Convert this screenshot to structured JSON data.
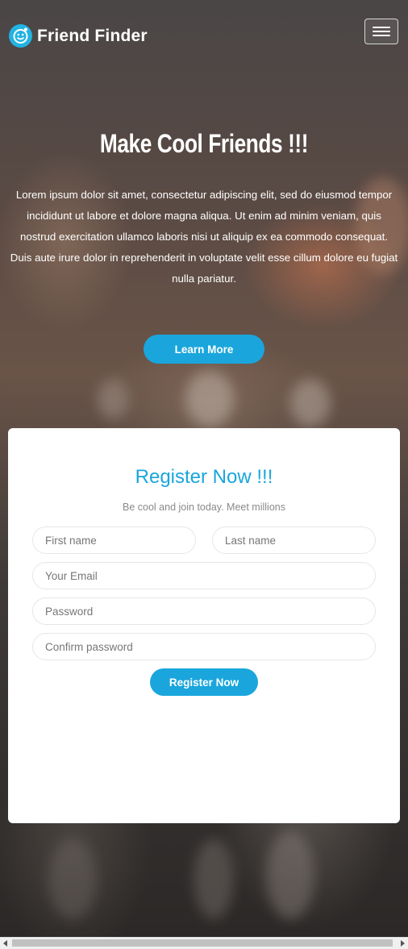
{
  "brand": {
    "name": "Friend Finder",
    "logo_icon": "smiley-face-icon",
    "accent_color": "#1aa6dc"
  },
  "navbar": {
    "menu_icon": "hamburger-menu-icon"
  },
  "hero": {
    "title": "Make Cool Friends !!!",
    "text": "Lorem ipsum dolor sit amet, consectetur adipiscing elit, sed do eiusmod tempor incididunt ut labore et dolore magna aliqua. Ut enim ad minim veniam, quis nostrud exercitation ullamco laboris nisi ut aliquip ex ea commodo consequat. Duis aute irure dolor in reprehenderit in voluptate velit esse cillum dolore eu fugiat nulla pariatur.",
    "cta_label": "Learn More"
  },
  "register": {
    "title": "Register Now !!!",
    "subtitle": "Be cool and join today. Meet millions",
    "first_name_placeholder": "First name",
    "last_name_placeholder": "Last name",
    "email_placeholder": "Your Email",
    "password_placeholder": "Password",
    "confirm_password_placeholder": "Confirm password",
    "submit_label": "Register Now"
  }
}
